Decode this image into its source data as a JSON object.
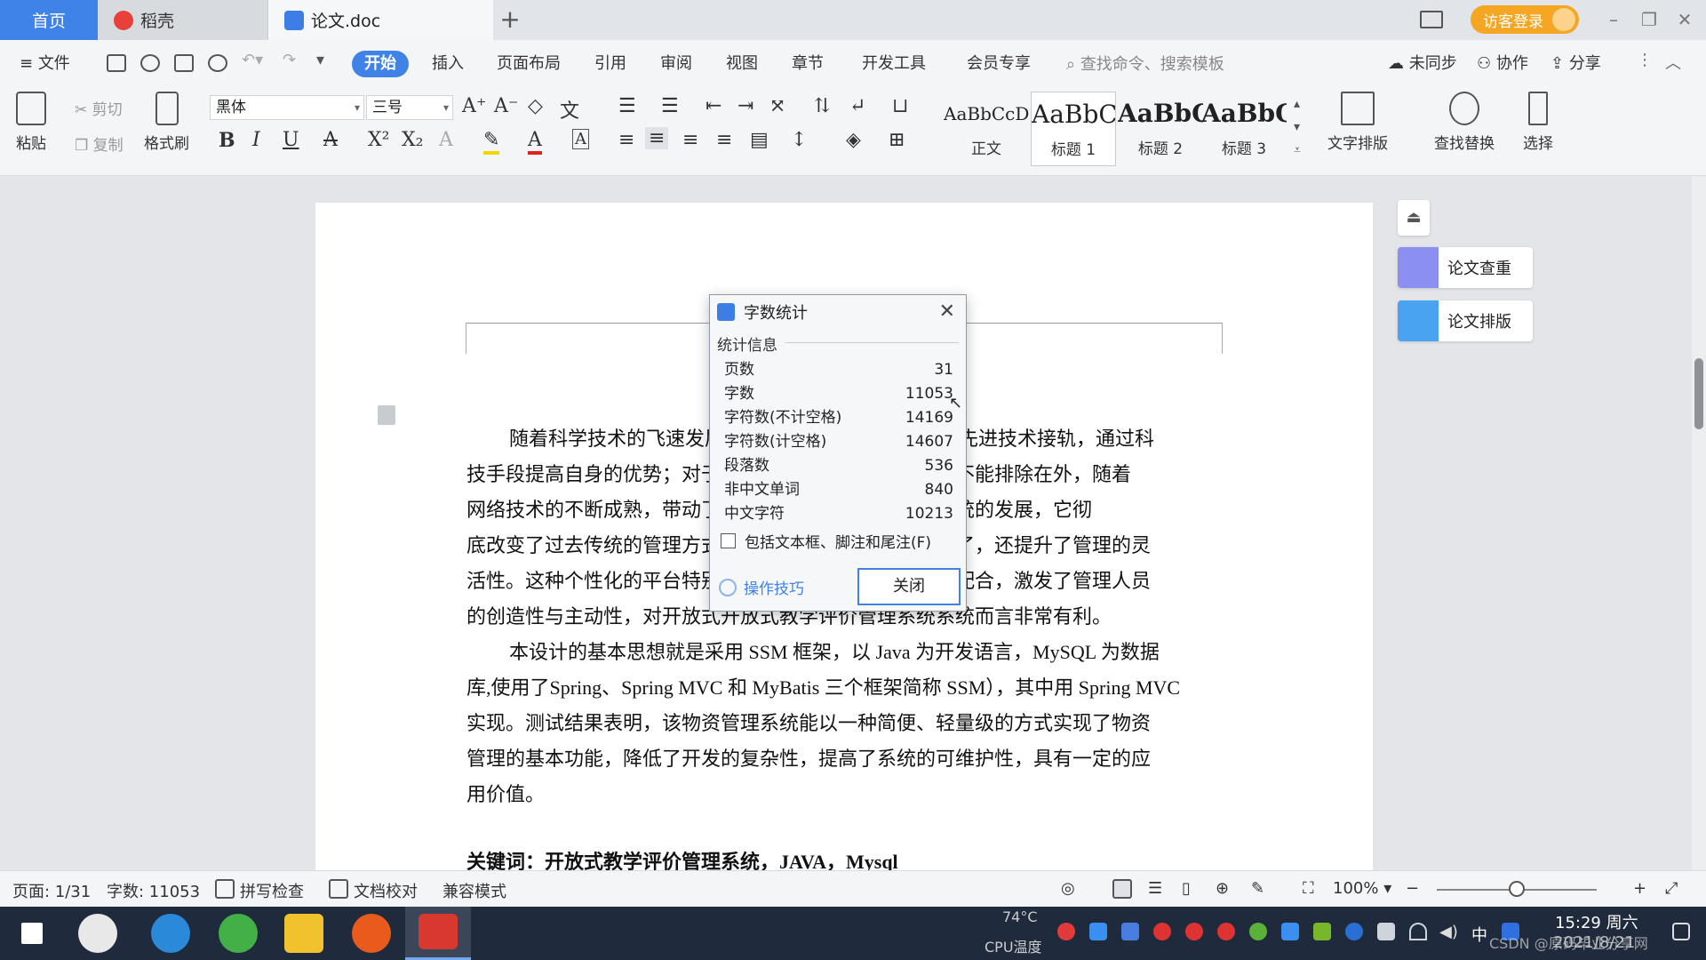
{
  "title_bar": {
    "tabs": [
      {
        "label": "首页"
      },
      {
        "label": "稻壳"
      },
      {
        "label": "论文.doc"
      }
    ],
    "new_tab": "+",
    "login_label": "访客登录"
  },
  "menu": {
    "file_label": "文件",
    "items": [
      "开始",
      "插入",
      "页面布局",
      "引用",
      "审阅",
      "视图",
      "章节",
      "开发工具",
      "会员专享"
    ],
    "search_placeholder": "查找命令、搜索模板",
    "sync_label": "未同步",
    "collab_label": "协作",
    "share_label": "分享"
  },
  "ribbon": {
    "paste": "粘贴",
    "cut": "剪切",
    "copy": "复制",
    "format_painter": "格式刷",
    "font_name": "黑体",
    "font_size": "三号",
    "styles": [
      {
        "sample": "AaBbCcDc",
        "name": "正文"
      },
      {
        "sample": "AaBbC",
        "name": "标题 1"
      },
      {
        "sample": "AaBbC",
        "name": "标题 2"
      },
      {
        "sample": "AaBbC",
        "name": "标题 3"
      }
    ],
    "text_layout": "文字排版",
    "find_replace": "查找替换",
    "select": "选择"
  },
  "document": {
    "para1_lines": [
      "随着科学技术的飞速发展，各行各业都在努力与现代先进技术接轨，通过科",
      "技手段提高自身的优势；对于开放式教学评价管理当然也不能排除在外，随着",
      "网络技术的不断成熟，带动了开放式教学评价管理系统系统的发展，它彻",
      "底改变了过去传统的管理方式，不仅使服务管理难度变低了，还提升了管理的灵",
      "活性。这种个性化的平台特别注重交互协调与管理的相互配合，激发了管理人员",
      "的创造性与主动性，对开放式开放式教学评价管理系统系统而言非常有利。"
    ],
    "para2_lines": [
      "本设计的基本思想就是采用 SSM 框架，以 Java 为开发语言，MySQL 为数据",
      "库,使用了Spring、Spring MVC 和 MyBatis 三个框架简称 SSM），其中用 Spring MVC",
      "实现。测试结果表明，该物资管理系统能以一种简便、轻量级的方式实现了物资",
      "管理的基本功能，降低了开发的复杂性，提高了系统的可维护性，具有一定的应",
      "用价值。"
    ],
    "keywords_line": "关键词：开放式教学评价管理系统，JAVA，Mysql"
  },
  "side_panel": {
    "check_label": "论文查重",
    "layout_label": "论文排版"
  },
  "dialog": {
    "title": "字数统计",
    "section": "统计信息",
    "stats": [
      {
        "label": "页数",
        "value": "31"
      },
      {
        "label": "字数",
        "value": "11053"
      },
      {
        "label": "字符数(不计空格)",
        "value": "14169"
      },
      {
        "label": "字符数(计空格)",
        "value": "14607"
      },
      {
        "label": "段落数",
        "value": "536"
      },
      {
        "label": "非中文单词",
        "value": "840"
      },
      {
        "label": "中文字符",
        "value": "10213"
      }
    ],
    "include_label": "包括文本框、脚注和尾注(F)",
    "include_checked": false,
    "tips_label": "操作技巧",
    "close_label": "关闭"
  },
  "status_bar": {
    "page": "页面: 1/31",
    "words": "字数: 11053",
    "spell": "拼写检查",
    "proof": "文档校对",
    "compat": "兼容模式",
    "zoom": "100%",
    "zoom_fraction": 0.5
  },
  "taskbar": {
    "cpu_temp": "74°C",
    "cpu_label": "CPU温度",
    "ime": "中",
    "time": "15:29 周六",
    "date": "2021/8/21",
    "watermark": "CSDN @原码毕业分享网"
  }
}
